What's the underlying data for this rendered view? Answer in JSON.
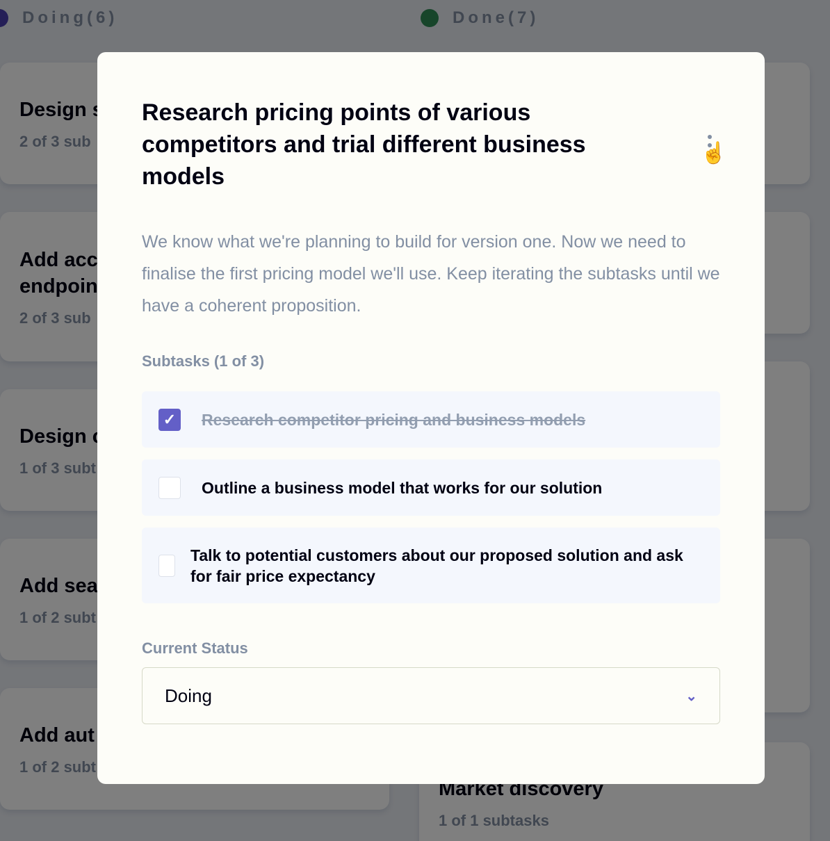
{
  "board": {
    "columns": [
      {
        "title": "Doing(6)",
        "color": "#4a3fae",
        "cards": [
          {
            "title": "Design s",
            "subtasks": "2 of 3 sub"
          },
          {
            "title": "Add acc endpoin",
            "subtasks": "2 of 3 sub"
          },
          {
            "title": "Design c",
            "subtasks": "1 of 3 subt"
          },
          {
            "title": "Add sea",
            "subtasks": "1 of 2 subt"
          },
          {
            "title": "Add aut",
            "subtasks": "1 of 2 subt"
          }
        ]
      },
      {
        "title": "Done(7)",
        "color": "#2f8a55",
        "cards": [
          {
            "title": "Market discovery",
            "subtasks": "1 of 1 subtasks"
          }
        ]
      }
    ]
  },
  "modal": {
    "title": "Research pricing points of various competitors and trial different business models",
    "description": "We know what we're planning to build for version one. Now we need to finalise the first pricing model we'll use. Keep iterating the subtasks until we have a coherent proposition.",
    "subtasks_label": "Subtasks (1 of 3)",
    "subtasks": [
      {
        "title": "Research competitor pricing and business models",
        "completed": true
      },
      {
        "title": "Outline a business model that works for our solution",
        "completed": false
      },
      {
        "title": "Talk to potential customers about our proposed solution and ask for fair price expectancy",
        "completed": false
      }
    ],
    "status_label": "Current Status",
    "status_value": "Doing"
  }
}
